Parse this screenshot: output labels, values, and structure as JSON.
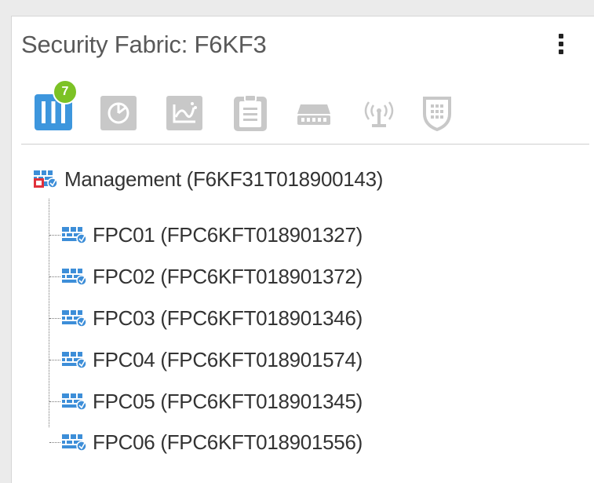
{
  "widget": {
    "title": "Security Fabric: F6KF3",
    "menu_icon": "kebab-menu-icon"
  },
  "toolbar": {
    "items": [
      {
        "icon": "firewall-columns-icon",
        "badge": "7",
        "active": true
      },
      {
        "icon": "pie-chart-icon",
        "active": false
      },
      {
        "icon": "line-chart-icon",
        "active": false
      },
      {
        "icon": "clipboard-icon",
        "active": false
      },
      {
        "icon": "switch-icon",
        "active": false
      },
      {
        "icon": "wireless-ap-icon",
        "active": false
      },
      {
        "icon": "shield-icon",
        "active": false
      }
    ]
  },
  "tree": {
    "root": {
      "label": "Management (F6KF31T018900143)",
      "icon": "firewall-root-icon"
    },
    "children": [
      {
        "label": "FPC01 (FPC6KFT018901327)",
        "icon": "firewall-device-icon"
      },
      {
        "label": "FPC02 (FPC6KFT018901372)",
        "icon": "firewall-device-icon"
      },
      {
        "label": "FPC03 (FPC6KFT018901346)",
        "icon": "firewall-device-icon"
      },
      {
        "label": "FPC04 (FPC6KFT018901574)",
        "icon": "firewall-device-icon"
      },
      {
        "label": "FPC05 (FPC6KFT018901345)",
        "icon": "firewall-device-icon"
      },
      {
        "label": "FPC06 (FPC6KFT018901556)",
        "icon": "firewall-device-icon"
      }
    ]
  },
  "colors": {
    "active_icon": "#3d96dd",
    "inactive_icon": "#c8c8c8",
    "badge": "#7cc225",
    "device_blue": "#3d8ed8",
    "root_red": "#e0303a"
  }
}
